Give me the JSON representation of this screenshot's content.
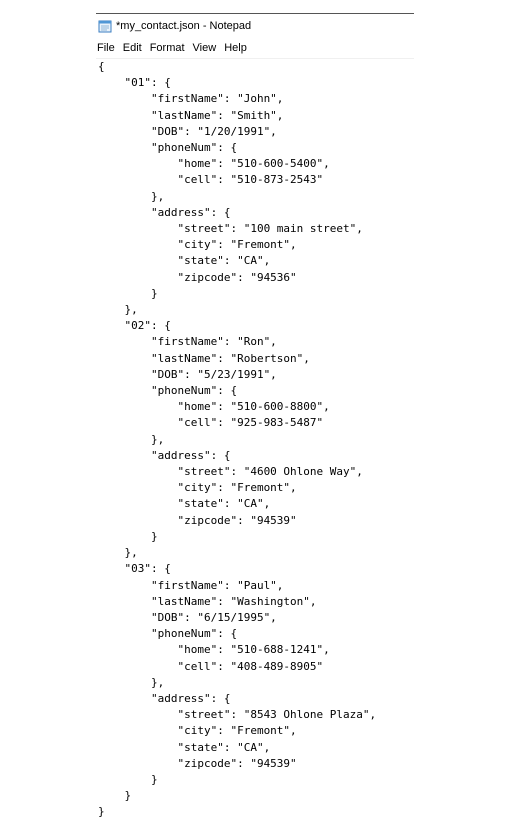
{
  "window": {
    "title": "*my_contact.json - Notepad"
  },
  "menu": {
    "items": [
      "File",
      "Edit",
      "Format",
      "View",
      "Help"
    ]
  },
  "editor": {
    "content": "{\n    \"01\": {\n        \"firstName\": \"John\",\n        \"lastName\": \"Smith\",\n        \"DOB\": \"1/20/1991\",\n        \"phoneNum\": {\n            \"home\": \"510-600-5400\",\n            \"cell\": \"510-873-2543\"\n        },\n        \"address\": {\n            \"street\": \"100 main street\",\n            \"city\": \"Fremont\",\n            \"state\": \"CA\",\n            \"zipcode\": \"94536\"\n        }\n    },\n    \"02\": {\n        \"firstName\": \"Ron\",\n        \"lastName\": \"Robertson\",\n        \"DOB\": \"5/23/1991\",\n        \"phoneNum\": {\n            \"home\": \"510-600-8800\",\n            \"cell\": \"925-983-5487\"\n        },\n        \"address\": {\n            \"street\": \"4600 Ohlone Way\",\n            \"city\": \"Fremont\",\n            \"state\": \"CA\",\n            \"zipcode\": \"94539\"\n        }\n    },\n    \"03\": {\n        \"firstName\": \"Paul\",\n        \"lastName\": \"Washington\",\n        \"DOB\": \"6/15/1995\",\n        \"phoneNum\": {\n            \"home\": \"510-688-1241\",\n            \"cell\": \"408-489-8905\"\n        },\n        \"address\": {\n            \"street\": \"8543 Ohlone Plaza\",\n            \"city\": \"Fremont\",\n            \"state\": \"CA\",\n            \"zipcode\": \"94539\"\n        }\n    }\n}"
  },
  "icons": {
    "app": "notepad-icon"
  }
}
